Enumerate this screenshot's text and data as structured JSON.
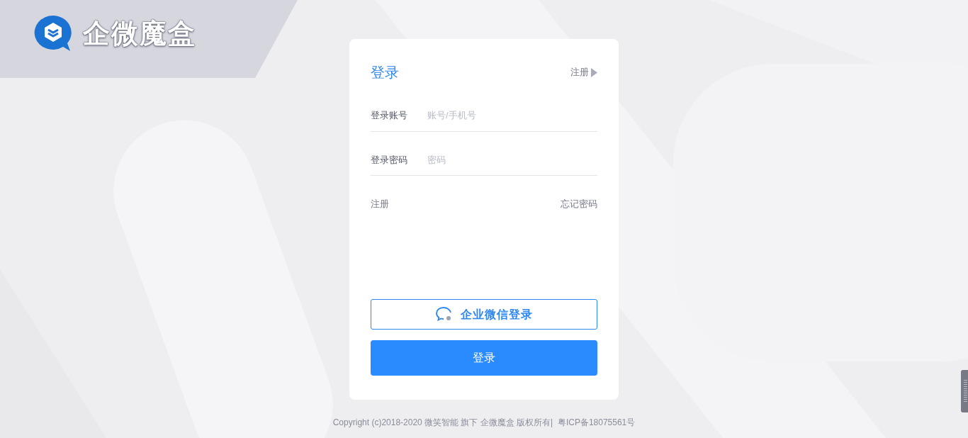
{
  "logo": {
    "text": "企微魔盒"
  },
  "login_card": {
    "title": "登录",
    "register_link": "注册",
    "fields": [
      {
        "label": "登录账号",
        "placeholder": "账号/手机号"
      },
      {
        "label": "登录密码",
        "placeholder": "密码"
      }
    ],
    "links": {
      "left": "注册",
      "right": "忘记密码"
    },
    "wecom_button": "企业微信登录",
    "login_button": "登录"
  },
  "footer": "Copyright (c)2018-2020 微笑智能 旗下 企微魔盒 版权所有|  粤ICP备18075561号"
}
